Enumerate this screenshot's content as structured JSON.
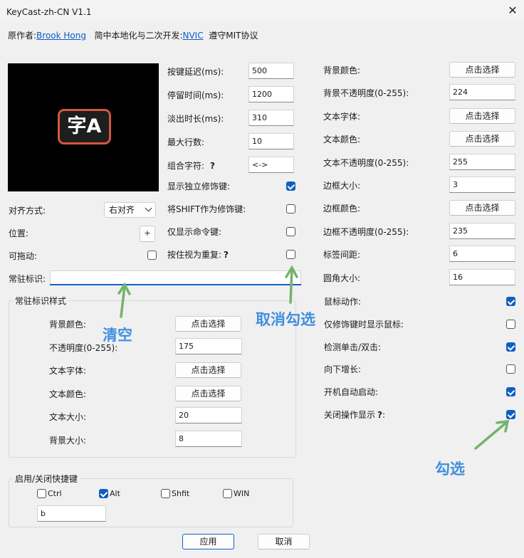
{
  "window": {
    "title": "KeyCast-zh-CN V1.1",
    "close_icon": "close-icon"
  },
  "credits": {
    "author_prefix": "原作者:",
    "author_name": "Brook Hong",
    "localizer_prefix": "简中本地化与二次开发:",
    "localizer_name": "NVIC",
    "license": "遵守MIT协议"
  },
  "preview": {
    "badge_text": "字A"
  },
  "left": {
    "align_label": "对齐方式:",
    "align_value": "右对齐",
    "position_label": "位置:",
    "position_button": "+",
    "draggable_label": "可拖动:",
    "draggable_checked": false,
    "pinned_label": "常驻标识:",
    "pinned_value": ""
  },
  "pinned_style": {
    "group_title": "常驻标识样式",
    "rows": [
      {
        "label": "背景颜色:",
        "kind": "button",
        "value": "点击选择"
      },
      {
        "label": "不透明度(0-255):",
        "kind": "input",
        "value": "175"
      },
      {
        "label": "文本字体:",
        "kind": "button",
        "value": "点击选择"
      },
      {
        "label": "文本颜色:",
        "kind": "button",
        "value": "点击选择"
      },
      {
        "label": "文本大小:",
        "kind": "input",
        "value": "20"
      },
      {
        "label": "背景大小:",
        "kind": "input",
        "value": "8"
      }
    ]
  },
  "hotkey": {
    "group_title": "启用/关闭快捷键",
    "options": [
      {
        "label": "Ctrl",
        "checked": false
      },
      {
        "label": "Alt",
        "checked": true
      },
      {
        "label": "Shfit",
        "checked": false
      },
      {
        "label": "WIN",
        "checked": false
      }
    ],
    "key_value": "b"
  },
  "middle": {
    "inputs": [
      {
        "label": "按键延迟(ms):",
        "value": "500"
      },
      {
        "label": "停留时间(ms):",
        "value": "1200"
      },
      {
        "label": "淡出时长(ms):",
        "value": "310"
      },
      {
        "label": "最大行数:",
        "value": "10"
      },
      {
        "label": "组合字符:",
        "help": "?",
        "value": "<->"
      }
    ],
    "checks": [
      {
        "label": "显示独立修饰键:",
        "checked": true
      },
      {
        "label": "将SHIFT作为修饰键:",
        "checked": false
      },
      {
        "label": "仅显示命令键:",
        "checked": false
      },
      {
        "label": "按住视为重复:",
        "help": "?",
        "checked": false
      }
    ]
  },
  "right": {
    "rows": [
      {
        "label": "背景颜色:",
        "kind": "button",
        "value": "点击选择"
      },
      {
        "label": "背景不透明度(0-255):",
        "kind": "input",
        "value": "224"
      },
      {
        "label": "文本字体:",
        "kind": "button",
        "value": "点击选择"
      },
      {
        "label": "文本颜色:",
        "kind": "button",
        "value": "点击选择"
      },
      {
        "label": "文本不透明度(0-255):",
        "kind": "input",
        "value": "255"
      },
      {
        "label": "边框大小:",
        "kind": "input",
        "value": "3"
      },
      {
        "label": "边框颜色:",
        "kind": "button",
        "value": "点击选择"
      },
      {
        "label": "边框不透明度(0-255):",
        "kind": "input",
        "value": "235"
      },
      {
        "label": "标签间距:",
        "kind": "input",
        "value": "6"
      },
      {
        "label": "圆角大小:",
        "kind": "input",
        "value": "16"
      }
    ],
    "checks": [
      {
        "label": "鼠标动作:",
        "checked": true
      },
      {
        "label": "仅修饰键时显示鼠标:",
        "checked": false
      },
      {
        "label": "检测单击/双击:",
        "checked": true
      },
      {
        "label": "向下增长:",
        "checked": false
      },
      {
        "label": "开机自动启动:",
        "checked": true
      },
      {
        "label": "关闭操作显示",
        "help": "?",
        "suffix": ":",
        "checked": true
      }
    ]
  },
  "footer": {
    "apply": "应用",
    "cancel": "取消"
  },
  "annotations": {
    "clear": "清空",
    "uncheck": "取消勾选",
    "check": "勾选",
    "color": "#3f8fe0"
  }
}
